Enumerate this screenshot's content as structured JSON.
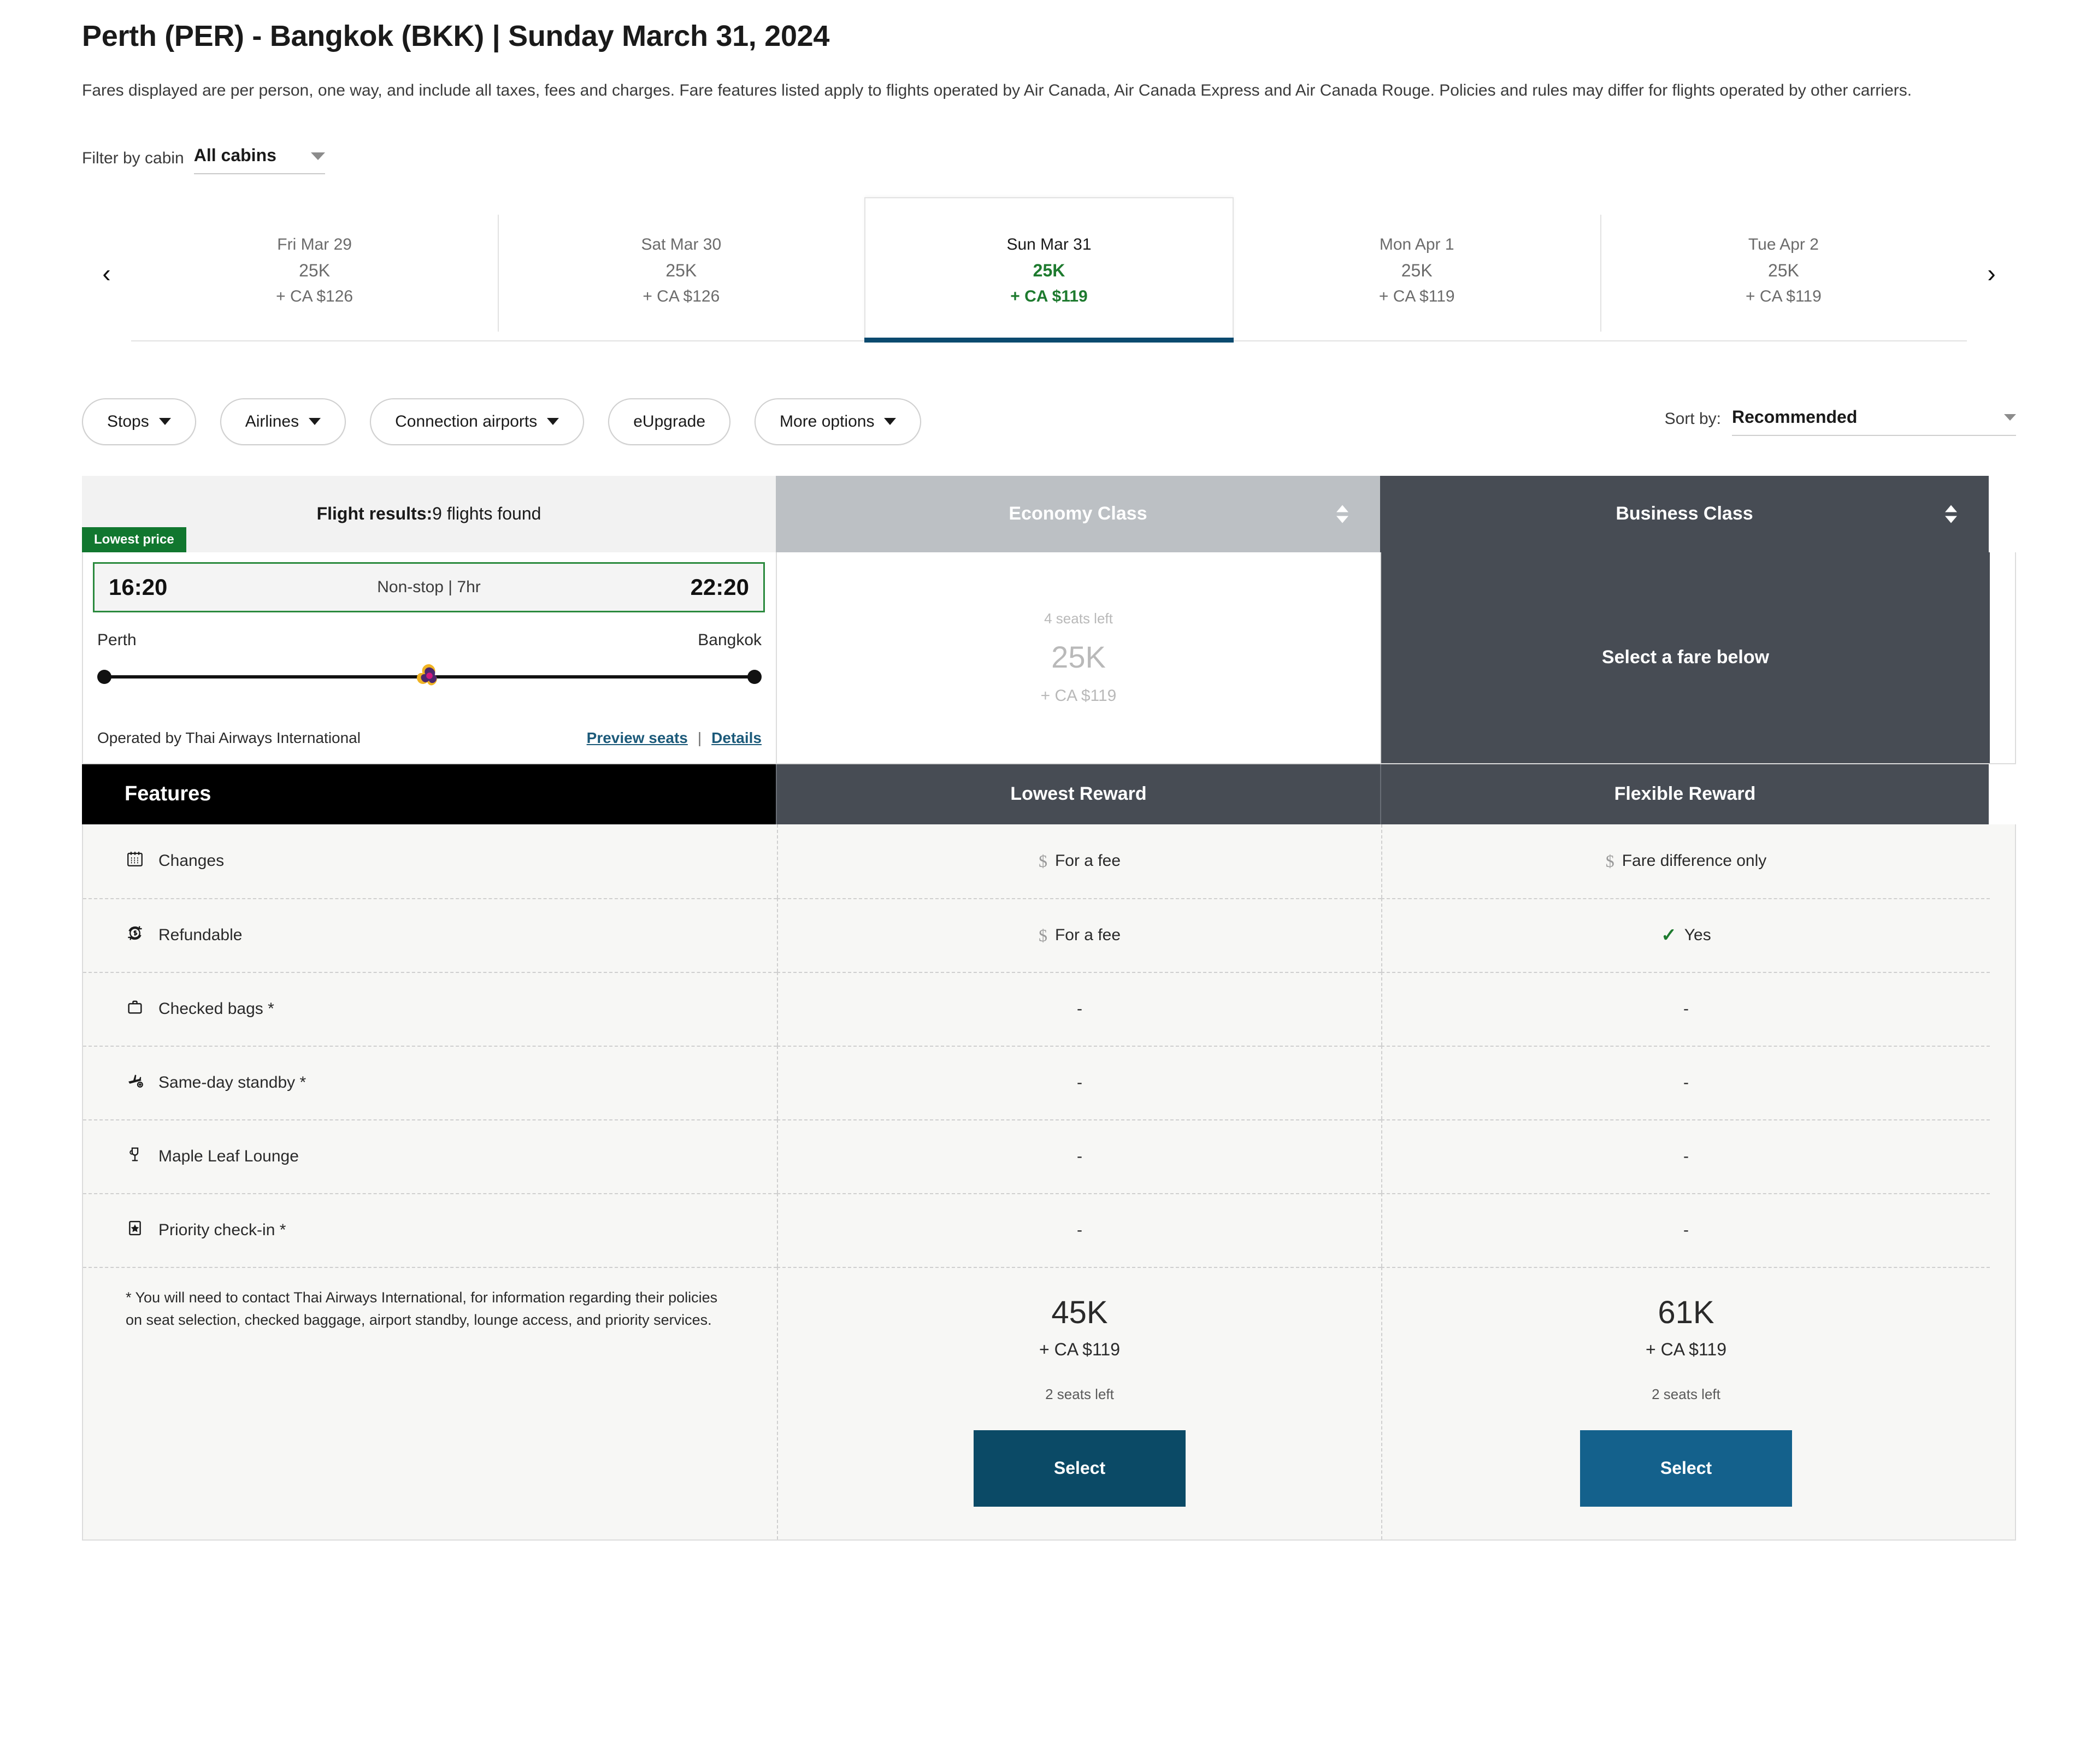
{
  "header": {
    "title": "Perth (PER) - Bangkok (BKK)  |  Sunday March 31, 2024",
    "subtitle": "Fares displayed are per person, one way, and include all taxes, fees and charges. Fare features listed apply to flights operated by Air Canada, Air Canada Express and Air Canada Rouge. Policies and rules may differ for flights operated by other carriers."
  },
  "cabin_filter": {
    "label": "Filter by cabin",
    "value": "All cabins"
  },
  "date_strip": {
    "prev_icon": "chevron-left-icon",
    "next_icon": "chevron-right-icon",
    "days": [
      {
        "date": "Fri Mar 29",
        "points": "25K",
        "cash": "+ CA $126",
        "selected": false
      },
      {
        "date": "Sat Mar 30",
        "points": "25K",
        "cash": "+ CA $126",
        "selected": false
      },
      {
        "date": "Sun Mar 31",
        "points": "25K",
        "cash": "+ CA $119",
        "selected": true
      },
      {
        "date": "Mon Apr 1",
        "points": "25K",
        "cash": "+ CA $119",
        "selected": false
      },
      {
        "date": "Tue Apr 2",
        "points": "25K",
        "cash": "+ CA $119",
        "selected": false
      }
    ]
  },
  "filters": {
    "pills": [
      {
        "label": "Stops",
        "caret": true
      },
      {
        "label": "Airlines",
        "caret": true
      },
      {
        "label": "Connection airports",
        "caret": true
      },
      {
        "label": "eUpgrade",
        "caret": false
      },
      {
        "label": "More options",
        "caret": true
      }
    ],
    "sort_label": "Sort by:",
    "sort_value": "Recommended"
  },
  "results_header": {
    "results_label": "Flight results:",
    "results_count": "9 flights found",
    "economy": "Economy Class",
    "business": "Business Class"
  },
  "flight": {
    "badge": "Lowest price",
    "depart_time": "16:20",
    "arrive_time": "22:20",
    "duration": "Non-stop | 7hr",
    "origin": "Perth",
    "destination": "Bangkok",
    "operated_by": "Operated by Thai Airways International",
    "preview_seats": "Preview seats",
    "separator": "|",
    "details": "Details",
    "economy": {
      "seats_left": "4 seats left",
      "points": "25K",
      "cash": "+ CA $119"
    },
    "business": {
      "message": "Select a fare below"
    }
  },
  "features_table": {
    "header": {
      "features": "Features",
      "lowest": "Lowest Reward",
      "flexible": "Flexible Reward"
    },
    "rows": [
      {
        "icon": "calendar-icon",
        "label": "Changes",
        "lowest": "For a fee",
        "lowest_icon": "dollar-icon",
        "flexible": "Fare difference only",
        "flexible_icon": "dollar-icon"
      },
      {
        "icon": "refund-dollar-icon",
        "label": "Refundable",
        "lowest": "For a fee",
        "lowest_icon": "dollar-icon",
        "flexible": "Yes",
        "flexible_icon": "check-icon"
      },
      {
        "icon": "suitcase-icon",
        "label": "Checked bags *",
        "lowest": "-",
        "lowest_icon": "",
        "flexible": "-",
        "flexible_icon": ""
      },
      {
        "icon": "standby-plane-icon",
        "label": "Same-day standby *",
        "lowest": "-",
        "lowest_icon": "",
        "flexible": "-",
        "flexible_icon": ""
      },
      {
        "icon": "lounge-glass-icon",
        "label": "Maple Leaf Lounge",
        "lowest": "-",
        "lowest_icon": "",
        "flexible": "-",
        "flexible_icon": ""
      },
      {
        "icon": "priority-star-icon",
        "label": "Priority check-in *",
        "lowest": "-",
        "lowest_icon": "",
        "flexible": "-",
        "flexible_icon": ""
      }
    ],
    "footnote": "* You will need to contact Thai Airways International, for information regarding their policies on seat selection, checked baggage, airport standby, lounge access, and priority services.",
    "fares": [
      {
        "points": "45K",
        "cash": "+ CA $119",
        "seats": "2 seats left",
        "button": "Select"
      },
      {
        "points": "61K",
        "cash": "+ CA $119",
        "seats": "2 seats left",
        "button": "Select"
      }
    ]
  },
  "colors": {
    "green": "#1d7a2e",
    "badge_green": "#11772f",
    "dark_slate": "#474c54",
    "economy_gray": "#bcc0c4",
    "select_dark": "#0b4a66",
    "select_bright": "#14618c",
    "link_blue": "#1c5a7a",
    "tab_underline": "#0b4a6f"
  }
}
